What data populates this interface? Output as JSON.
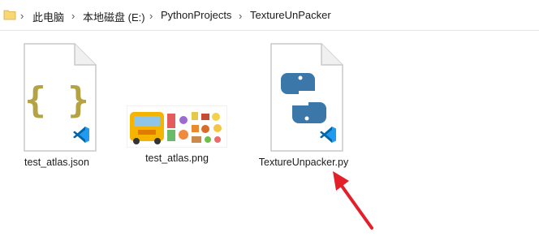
{
  "breadcrumb": {
    "items": [
      {
        "label": "此电脑"
      },
      {
        "label": "本地磁盘 (E:)"
      },
      {
        "label": "PythonProjects"
      },
      {
        "label": "TextureUnPacker"
      }
    ],
    "separator": "›"
  },
  "files": [
    {
      "name": "test_atlas.json",
      "icon": "json-file-icon",
      "app_badge": "vscode-icon"
    },
    {
      "name": "test_atlas.png",
      "icon": "image-thumbnail"
    },
    {
      "name": "TextureUnpacker.py",
      "icon": "python-file-icon",
      "app_badge": "vscode-icon"
    }
  ],
  "colors": {
    "accent_blue": "#0065a9",
    "json_braces": "#b5a243",
    "python_blue": "#3b77a8",
    "arrow_red": "#e3202a"
  }
}
